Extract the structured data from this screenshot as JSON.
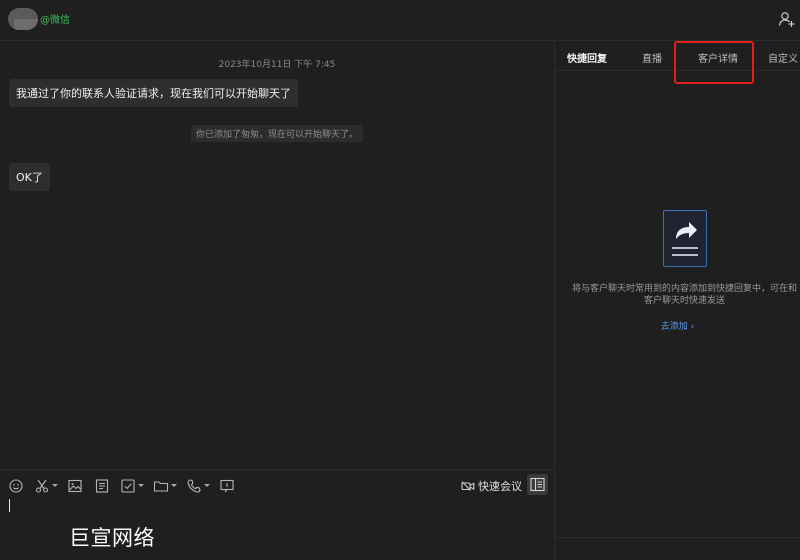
{
  "header": {
    "contact_source": "@微信",
    "add_contact_icon": "add-contact-icon"
  },
  "chat": {
    "timestamp": "2023年10月11日 下午 7:45",
    "messages": [
      "我通过了你的联系人验证请求，现在我们可以开始聊天了",
      "OK了"
    ],
    "system_note": "你已添加了匆匆，现在可以开始聊天了。"
  },
  "toolbar": {
    "icons": [
      "emoji-icon",
      "scissors-icon",
      "image-icon",
      "document-icon",
      "checkbox-icon",
      "folder-icon",
      "phone-icon",
      "screen-share-icon"
    ],
    "meeting_label": "快速会议",
    "side_panel_icon": "side-panel-icon"
  },
  "watermark": "巨宣网络",
  "panel": {
    "tabs": [
      "快捷回复",
      "直播",
      "客户详情",
      "自定义"
    ],
    "active_tab": "快捷回复",
    "empty_text": "将与客户聊天时常用到的内容添加到快捷回复中，可在和客户聊天时快速发送",
    "add_link": "去添加",
    "highlight_color": "#e0201b",
    "accent_color": "#3bc25a",
    "link_color": "#5b9bf0"
  }
}
